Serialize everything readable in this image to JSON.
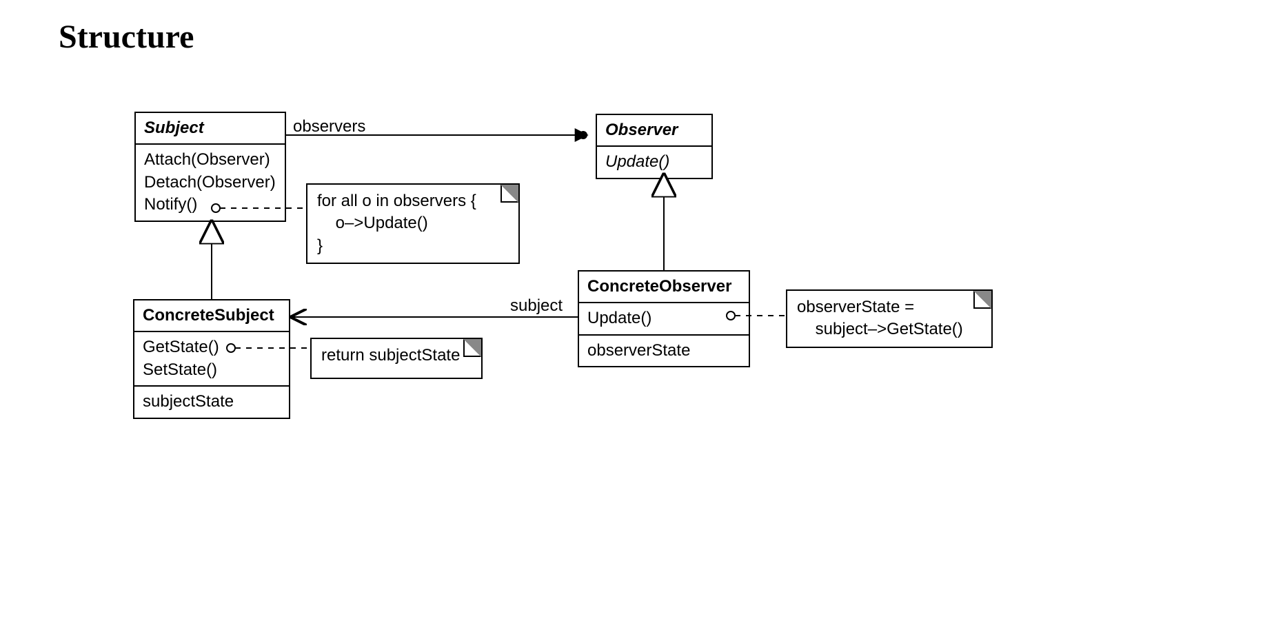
{
  "title": "Structure",
  "classes": {
    "subject": {
      "name": "Subject",
      "abstract": true,
      "methods": [
        "Attach(Observer)",
        "Detach(Observer)",
        "Notify()"
      ]
    },
    "observer": {
      "name": "Observer",
      "abstract": true,
      "methods": [
        "Update()"
      ]
    },
    "concreteSubject": {
      "name": "ConcreteSubject",
      "abstract": false,
      "methods": [
        "GetState()",
        "SetState()"
      ],
      "attributes": [
        "subjectState"
      ]
    },
    "concreteObserver": {
      "name": "ConcreteObserver",
      "abstract": false,
      "methods": [
        "Update()"
      ],
      "attributes": [
        "observerState"
      ]
    }
  },
  "notes": {
    "notify": {
      "lines": [
        "for all o in observers {",
        "    o–>Update()",
        "}"
      ]
    },
    "getState": {
      "lines": [
        "return subjectState"
      ]
    },
    "update": {
      "lines": [
        "observerState =",
        "    subject–>GetState()"
      ]
    }
  },
  "associations": {
    "observers": {
      "label": "observers"
    },
    "subject": {
      "label": "subject"
    }
  }
}
